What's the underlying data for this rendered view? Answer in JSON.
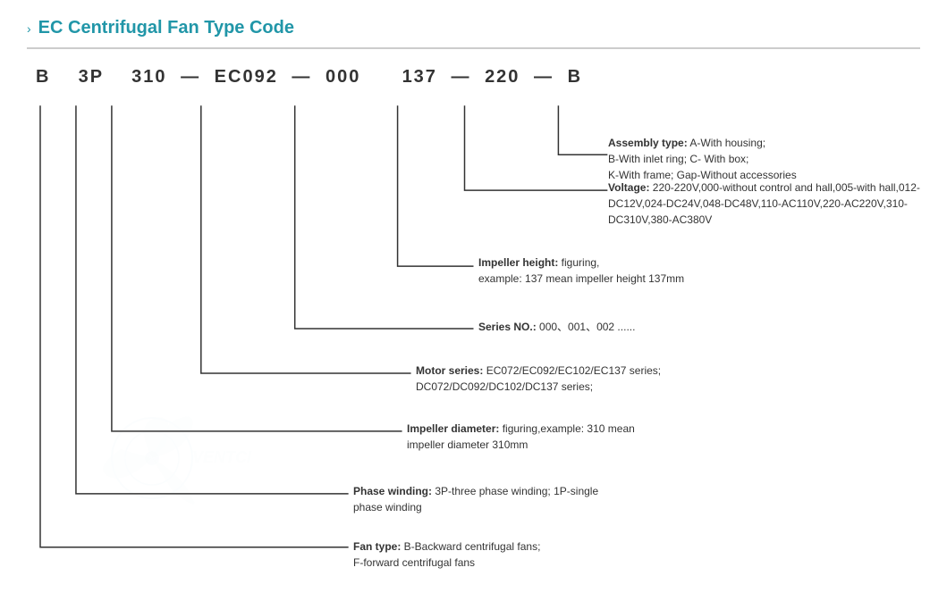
{
  "title": {
    "arrow": "›",
    "text": "EC Centrifugal Fan Type Code"
  },
  "type_code": {
    "parts": [
      "B",
      "3P",
      "310",
      "EC092",
      "000",
      "137",
      "220",
      "B"
    ],
    "dashes": [
      "—",
      "—",
      "—",
      "—",
      "—",
      "—"
    ]
  },
  "annotations": {
    "assembly": {
      "label": "Assembly type:",
      "text": "A-With housing;\nB-With inlet ring;  C- With box;\nK-With frame; Gap-Without accessories"
    },
    "voltage": {
      "label": "Voltage:",
      "text": "220-220V,000-without control and hall,005-with hall,012-DC12V,024-DC24V,048-DC48V,110-AC110V,220-AC220V,310-DC310V,380-AC380V"
    },
    "impeller_height": {
      "label": "Impeller height:",
      "text": "figuring,\nexample: 137 mean impeller height 137mm"
    },
    "series": {
      "label": "Series NO.:",
      "text": "000、001、002 ......"
    },
    "motor": {
      "label": "Motor series:",
      "text": "EC072/EC092/EC102/EC137 series;\nDC072/DC092/DC102/DC137 series;"
    },
    "impeller_diameter": {
      "label": "Impeller diameter:",
      "text": "figuring,example: 310 mean\nimpeller diameter 310mm"
    },
    "phase": {
      "label": "Phase winding:",
      "text": "3P-three phase winding;  1P-single\nphase winding"
    },
    "fan_type": {
      "label": "Fan type:",
      "text": "B-Backward centrifugal fans;\nF-forward centrifugal fans"
    }
  }
}
